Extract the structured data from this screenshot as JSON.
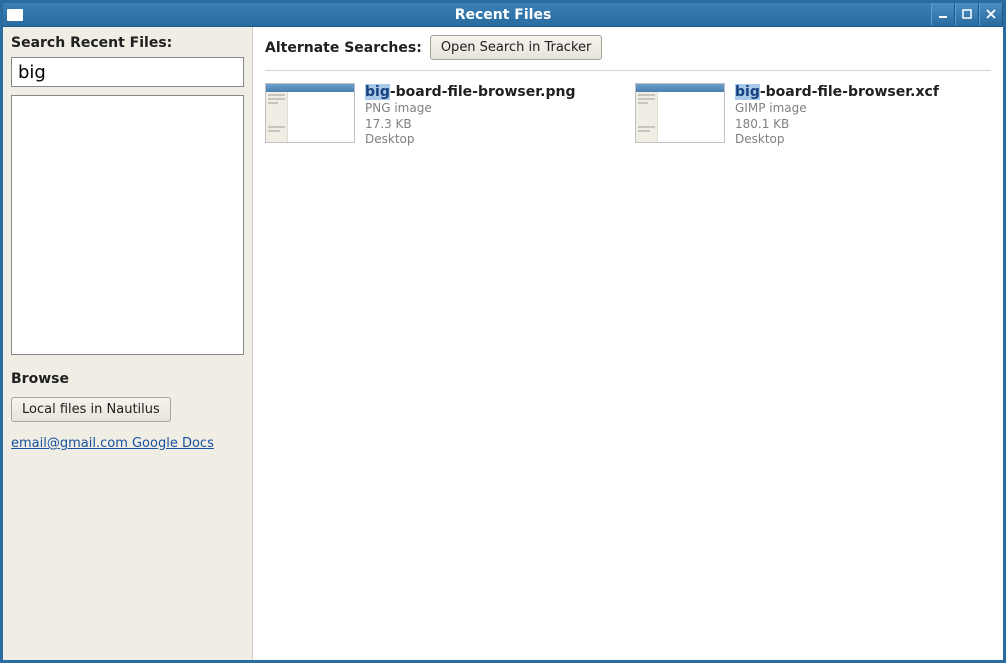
{
  "window": {
    "title": "Recent Files"
  },
  "sidebar": {
    "search_label": "Search Recent Files:",
    "search_value": "big",
    "browse_label": "Browse",
    "local_files_button": "Local files in Nautilus",
    "google_docs_link": "email@gmail.com Google Docs"
  },
  "main": {
    "alt_search_label": "Alternate Searches:",
    "open_tracker_button": "Open Search in Tracker"
  },
  "files": [
    {
      "highlight": "big",
      "rest": "-board-file-browser.png",
      "type": "PNG image",
      "size": "17.3 KB",
      "location": "Desktop"
    },
    {
      "highlight": "big",
      "rest": "-board-file-browser.xcf",
      "type": "GIMP image",
      "size": "180.1 KB",
      "location": "Desktop"
    }
  ]
}
